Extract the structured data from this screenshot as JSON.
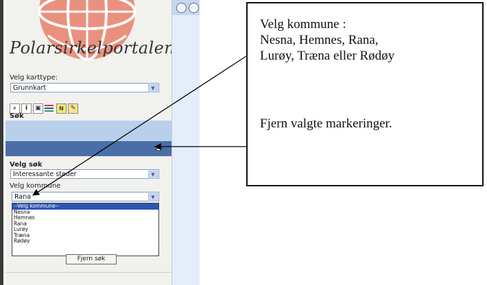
{
  "logo": {
    "text": "Polarsirkelportalen"
  },
  "map_type": {
    "label": "Velg karttype:",
    "selected": "Grunnkart"
  },
  "search_panel": {
    "title": "Søk",
    "velg_sok_label": "Velg søk",
    "velg_sok_selected": "Interessante steder",
    "kommune_label": "Velg kommune",
    "kommune_selected": "Rana",
    "kommune_options": [
      "--Velg kommune--",
      "Nesna",
      "Hemnes",
      "Rana",
      "Lurøy",
      "Træna",
      "Rødøy"
    ],
    "clear_button": "Fjern søk"
  },
  "callout": {
    "line1": "Velg kommune :",
    "line2": "Nesna, Hemnes, Rana,",
    "line3": "Lurøy, Træna eller Rødøy",
    "line4": "Fjern valgte markeringer."
  },
  "colors": {
    "light_band": "#b9d0ec",
    "dark_band": "#4a6fa8",
    "selected_option": "#2b55b3",
    "globe": "#e8806a"
  },
  "icons": [
    "zoom-icon",
    "info-icon",
    "layers-icon",
    "legend-icon",
    "north-arrow-icon",
    "draw-icon",
    "eraser-icon",
    "globe-logo-icon"
  ]
}
